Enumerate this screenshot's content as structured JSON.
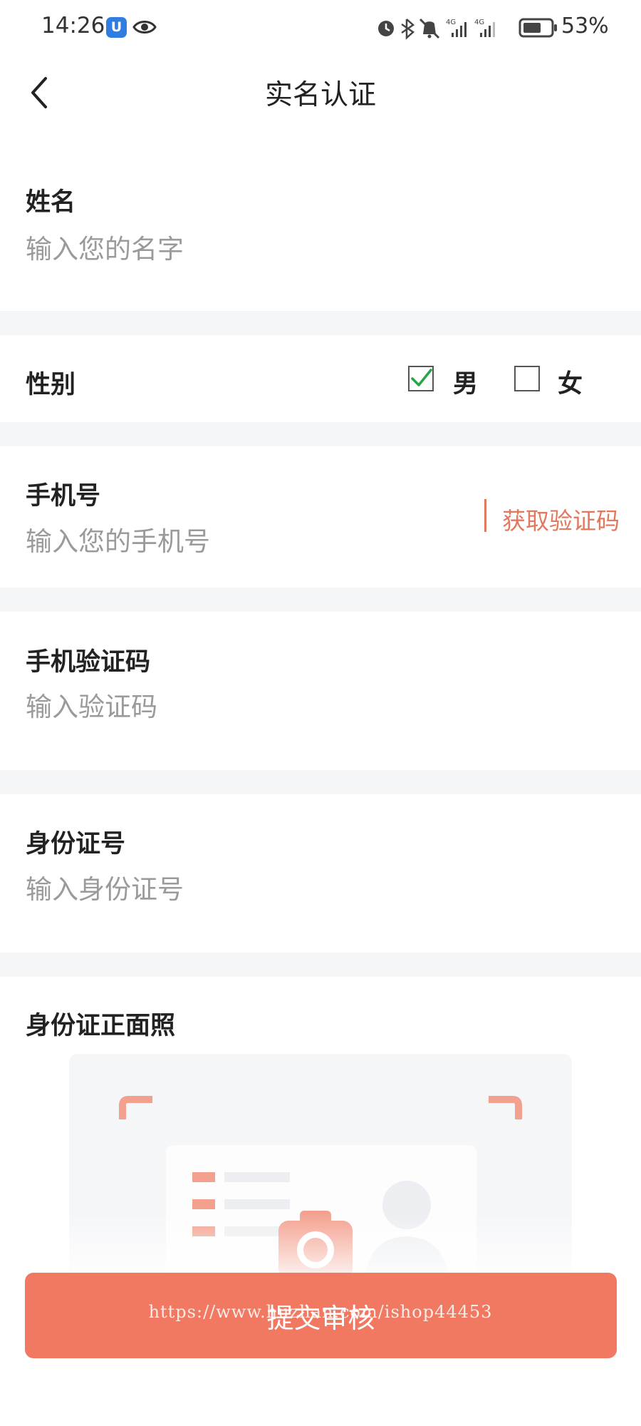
{
  "status_bar": {
    "time": "14:26",
    "battery": "53%",
    "app_badge": "U"
  },
  "header": {
    "title": "实名认证"
  },
  "form": {
    "name": {
      "label": "姓名",
      "placeholder": "输入您的名字"
    },
    "gender": {
      "label": "性别",
      "options": [
        "男",
        "女"
      ],
      "selected": "男"
    },
    "phone": {
      "label": "手机号",
      "placeholder": "输入您的手机号",
      "get_code": "获取验证码"
    },
    "sms_code": {
      "label": "手机验证码",
      "placeholder": "输入验证码"
    },
    "id_number": {
      "label": "身份证号",
      "placeholder": "输入身份证号"
    },
    "id_front_photo": {
      "label": "身份证正面照"
    }
  },
  "submit": {
    "label": "提交审核"
  },
  "watermark": "https://www.huzhan.com/ishop44453",
  "colors": {
    "accent": "#f27961",
    "link": "#e2785e",
    "check": "#2aa34a",
    "separator": "#f5f6f8"
  }
}
